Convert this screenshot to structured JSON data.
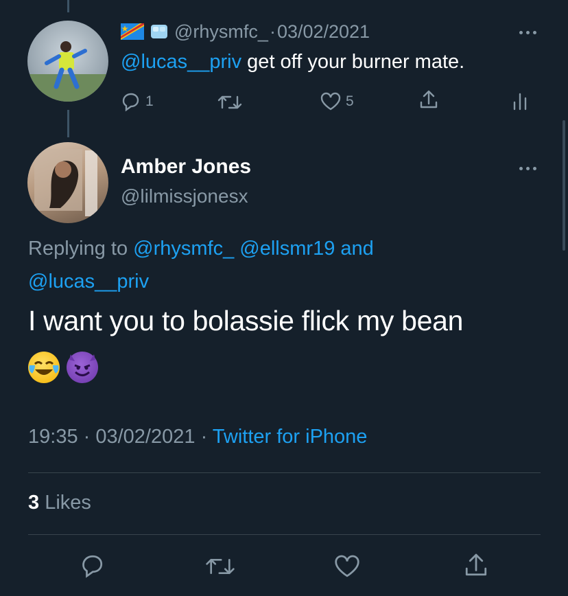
{
  "parent_tweet": {
    "flags": [
      "flag-drc-icon",
      "ice-cube-icon"
    ],
    "handle": "@rhysmfc_",
    "separator": "·",
    "date": "03/02/2021",
    "mention": "@lucas__priv",
    "text": " get off your burner mate.",
    "reply_count": "1",
    "like_count": "5"
  },
  "tweet": {
    "display_name": "Amber Jones",
    "handle": "@lilmissjonesx",
    "replying_prefix": "Replying to ",
    "replying_mention_1": "@rhysmfc_",
    "replying_mention_2": "@ellsmr19",
    "replying_and": " and",
    "replying_mention_3": "@lucas__priv",
    "text": "I want you to bolassie flick my bean",
    "emojis": [
      "tears-of-joy-emoji",
      "smiling-devil-emoji"
    ],
    "time": "19:35",
    "dot": " · ",
    "date": "03/02/2021",
    "source": "Twitter for iPhone",
    "likes_count": "3",
    "likes_label": " Likes"
  },
  "colors": {
    "background": "#15202b",
    "accent": "#1da1f2",
    "muted": "#8899a6",
    "divider": "#38444d"
  }
}
